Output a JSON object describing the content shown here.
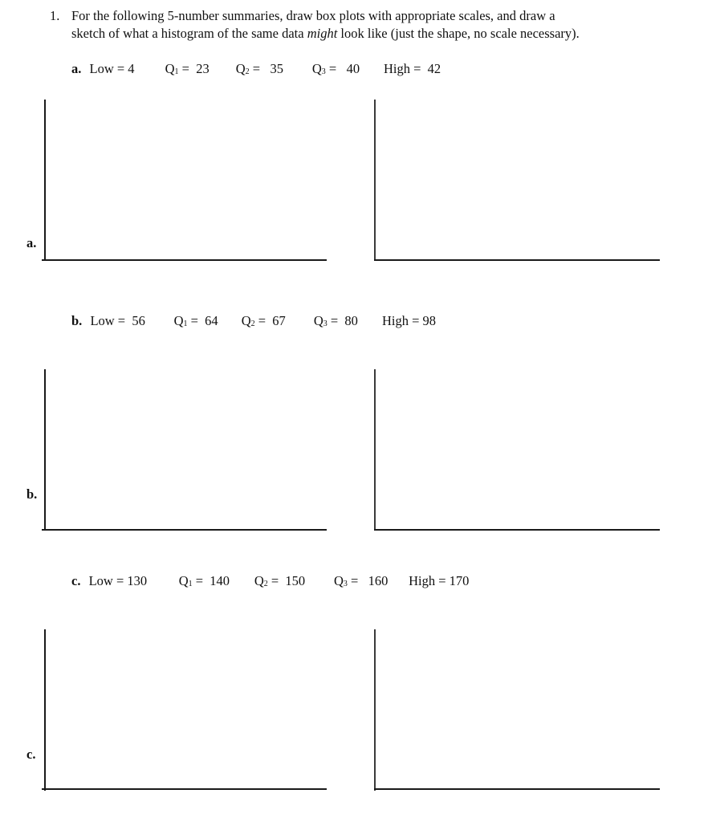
{
  "question": {
    "number": "1.",
    "line1": "For the following 5-number summaries, draw box plots with appropriate scales, and draw a",
    "line2_before": "sketch of what a histogram of the same data ",
    "line2_emphasis": "might",
    "line2_after": " look like (just the shape, no scale necessary)."
  },
  "parts": [
    {
      "label": "a.",
      "side_label": "a.",
      "low_text": "Low = 4",
      "q1_label": "Q",
      "q1_sub": "1",
      "q1_value": " =  23",
      "q2_label": "Q",
      "q2_sub": "2",
      "q2_value": " =   35",
      "q3_label": "Q",
      "q3_sub": "3",
      "q3_value": " =   40",
      "high_text": "High =  42",
      "values": {
        "low": 4,
        "q1": 23,
        "q2": 35,
        "q3": 40,
        "high": 42
      },
      "boxplot_axes_label": "box plot drawing area",
      "histogram_axes_label": "histogram sketch area"
    },
    {
      "label": "b.",
      "side_label": "b.",
      "low_text": "Low =  56",
      "q1_label": "Q",
      "q1_sub": "1",
      "q1_value": " =  64",
      "q2_label": "Q",
      "q2_sub": "2",
      "q2_value": " =  67",
      "q3_label": "Q",
      "q3_sub": "3",
      "q3_value": " =  80",
      "high_text": "High = 98",
      "values": {
        "low": 56,
        "q1": 64,
        "q2": 67,
        "q3": 80,
        "high": 98
      },
      "boxplot_axes_label": "box plot drawing area",
      "histogram_axes_label": "histogram sketch area"
    },
    {
      "label": "c.",
      "side_label": "c.",
      "low_text": "Low = 130",
      "q1_label": "Q",
      "q1_sub": "1",
      "q1_value": " =  140",
      "q2_label": "Q",
      "q2_sub": "2",
      "q2_value": " =  150",
      "q3_label": "Q",
      "q3_sub": "3",
      "q3_value": " =   160",
      "high_text": "High = 170",
      "values": {
        "low": 130,
        "q1": 140,
        "q2": 150,
        "q3": 160,
        "high": 170
      },
      "boxplot_axes_label": "box plot drawing area",
      "histogram_axes_label": "histogram sketch area"
    }
  ]
}
